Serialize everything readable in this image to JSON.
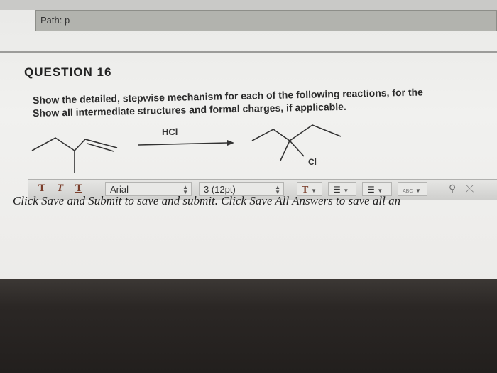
{
  "path": {
    "label": "Path: p"
  },
  "question": {
    "title": "QUESTION 16",
    "line1": "Show the detailed, stepwise mechanism for each of the following reactions, for the",
    "line2": "Show all intermediate structures and formal charges, if applicable."
  },
  "reaction": {
    "reagent": "HCl",
    "product_label": "Cl"
  },
  "toolbar": {
    "format_t1": "T",
    "format_t2": "T",
    "format_t3": "T",
    "font_family": "Arial",
    "font_size": "3 (12pt)",
    "text_color_icon": "T",
    "spellcheck_label": "ABC"
  },
  "footer": {
    "instructions": "Click Save and Submit to save and submit. Click Save All Answers to save all an"
  }
}
